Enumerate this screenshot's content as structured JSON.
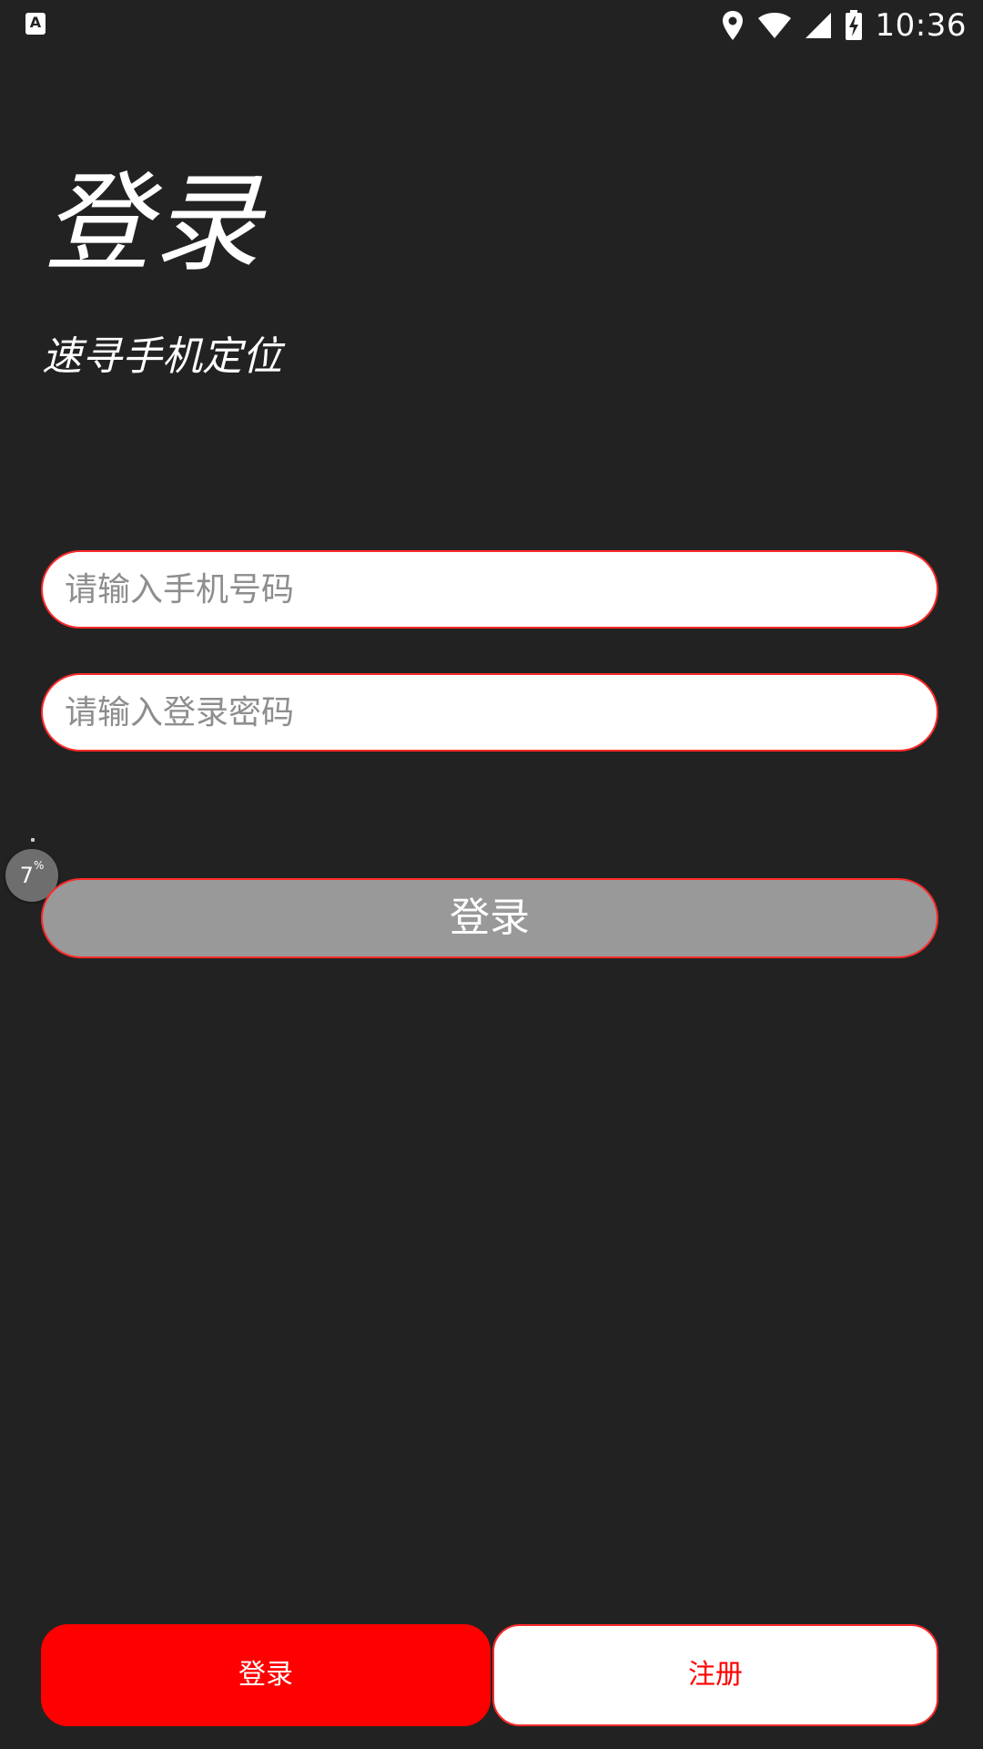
{
  "status_bar": {
    "left_icon": "A",
    "icons": [
      "location-icon",
      "wifi-icon",
      "signal-icon",
      "battery-charging-icon"
    ],
    "time": "10:36"
  },
  "header": {
    "title": "登录",
    "subtitle": "速寻手机定位"
  },
  "form": {
    "phone_placeholder": "请输入手机号码",
    "password_placeholder": "请输入登录密码",
    "login_button_label": "登录"
  },
  "floating_badge": {
    "value": "7",
    "unit": "%"
  },
  "bottom_tabs": {
    "login_label": "登录",
    "register_label": "注册"
  },
  "colors": {
    "background": "#222222",
    "accent": "#ff0000",
    "button_disabled": "#999999"
  }
}
